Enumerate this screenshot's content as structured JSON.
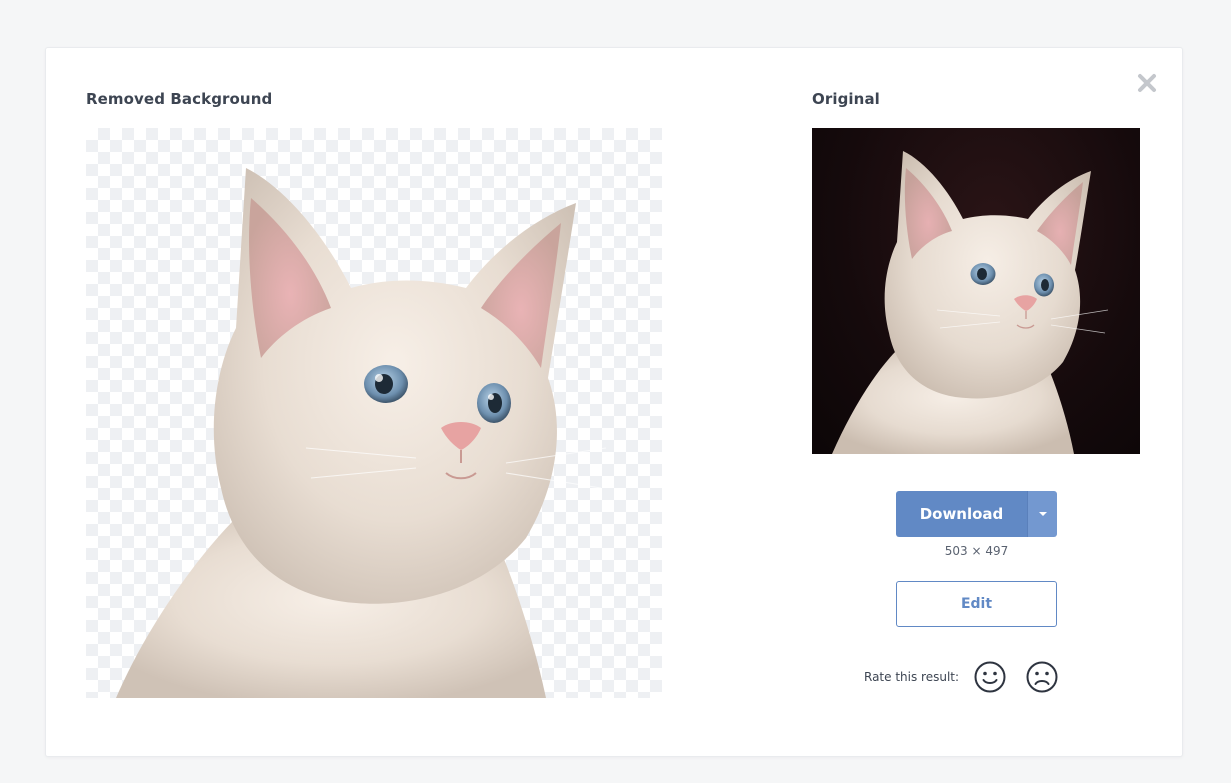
{
  "page": {
    "removed_title": "Removed Background",
    "original_title": "Original",
    "download_label": "Download",
    "dimensions": "503 × 497",
    "edit_label": "Edit",
    "rate_label": "Rate this result:"
  },
  "icons": {
    "close": "close-icon",
    "caret": "chevron-down-icon",
    "happy": "smiley-happy-icon",
    "sad": "smiley-sad-icon"
  },
  "colors": {
    "accent": "#6189c5",
    "title": "#3d4552",
    "close": "#c4c7cc"
  }
}
